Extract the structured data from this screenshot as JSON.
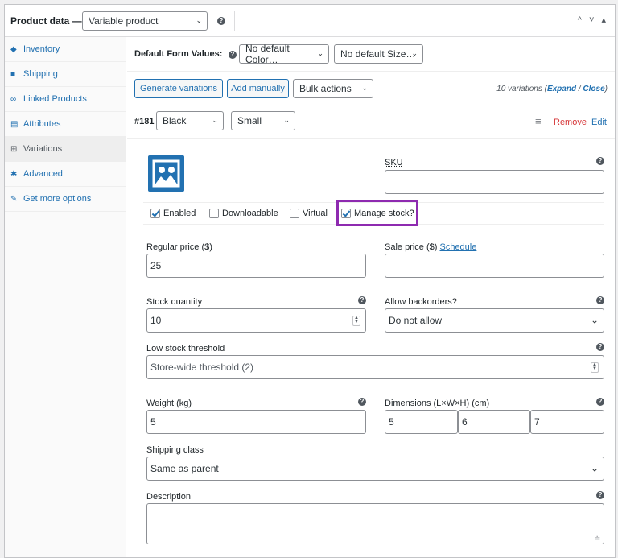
{
  "header": {
    "title": "Product data —",
    "product_type": "Variable product",
    "arrows": "^ ˅ ▴"
  },
  "sidebar": {
    "items": [
      {
        "label": "Inventory",
        "icon": "tag-icon"
      },
      {
        "label": "Shipping",
        "icon": "truck-icon"
      },
      {
        "label": "Linked Products",
        "icon": "link-icon"
      },
      {
        "label": "Attributes",
        "icon": "list-icon"
      },
      {
        "label": "Variations",
        "icon": "grid-icon"
      },
      {
        "label": "Advanced",
        "icon": "gear-icon"
      },
      {
        "label": "Get more options",
        "icon": "plugin-icon"
      }
    ]
  },
  "defaults": {
    "label": "Default Form Values:",
    "color": "No default Color…",
    "size": "No default Size…"
  },
  "toolbar": {
    "generate": "Generate variations",
    "add_manually": "Add manually",
    "bulk_actions": "Bulk actions",
    "count_text": "10 variations (",
    "expand": "Expand",
    "slash": " / ",
    "close": "Close",
    "count_end": ")"
  },
  "variation": {
    "id": "#181",
    "color": "Black",
    "size": "Small",
    "remove": "Remove",
    "edit": "Edit",
    "handle": "≡"
  },
  "form": {
    "sku_label": "SKU",
    "sku_value": "",
    "enabled": "Enabled",
    "downloadable": "Downloadable",
    "virtual": "Virtual",
    "manage_stock": "Manage stock?",
    "regular_price_label": "Regular price ($)",
    "regular_price": "25",
    "sale_price_label": "Sale price ($)",
    "schedule": "Schedule",
    "sale_price": "",
    "stock_qty_label": "Stock quantity",
    "stock_qty": "10",
    "backorders_label": "Allow backorders?",
    "backorders": "Do not allow",
    "low_stock_label": "Low stock threshold",
    "low_stock_placeholder": "Store-wide threshold (2)",
    "weight_label": "Weight (kg)",
    "weight": "5",
    "dimensions_label": "Dimensions (L×W×H) (cm)",
    "dim_l": "5",
    "dim_w": "6",
    "dim_h": "7",
    "shipping_class_label": "Shipping class",
    "shipping_class": "Same as parent",
    "description_label": "Description",
    "description": ""
  },
  "checked": {
    "enabled": true,
    "downloadable": false,
    "virtual": false,
    "manage_stock": true
  },
  "colors": {
    "accent": "#2271b1",
    "danger": "#d63638",
    "highlight": "#8e2ab0"
  }
}
